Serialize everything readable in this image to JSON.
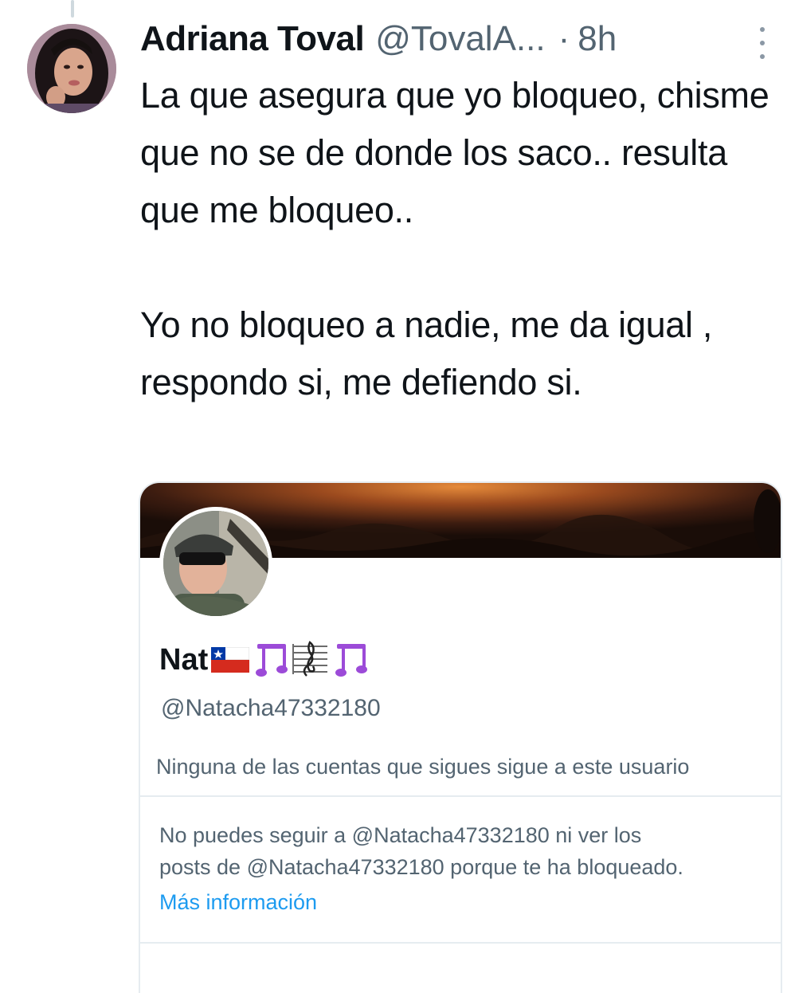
{
  "tweet": {
    "author_name": "Adriana Toval",
    "handle": "@TovalA...",
    "separator": "·",
    "timestamp": "8h",
    "icons": {
      "more": "more-vertical-icon"
    },
    "text": {
      "paragraph1": "La que asegura que yo bloqueo, chisme que no se de donde los saco.. resulta que me bloqueo..",
      "paragraph2": "Yo no bloqueo a nadie, me da igual , respondo si, me defiendo si."
    }
  },
  "profile_card": {
    "display_name": "Nat",
    "name_emojis": [
      "chile-flag-icon",
      "music-notes-icon",
      "musical-score-icon",
      "music-notes-icon"
    ],
    "handle": "@Natacha47332180",
    "followers_note": "Ninguna de las cuentas que sigues sigue a este usuario",
    "blocked_note": {
      "line1": "No puedes seguir a @Natacha47332180 ni ver los",
      "line2": "posts de @Natacha47332180 porque te ha bloqueado."
    },
    "more_info_link": "Más información"
  },
  "colors": {
    "text_primary": "#0f1419",
    "text_secondary": "#536471",
    "link": "#1d9bf0",
    "border": "#e6ecf0"
  }
}
